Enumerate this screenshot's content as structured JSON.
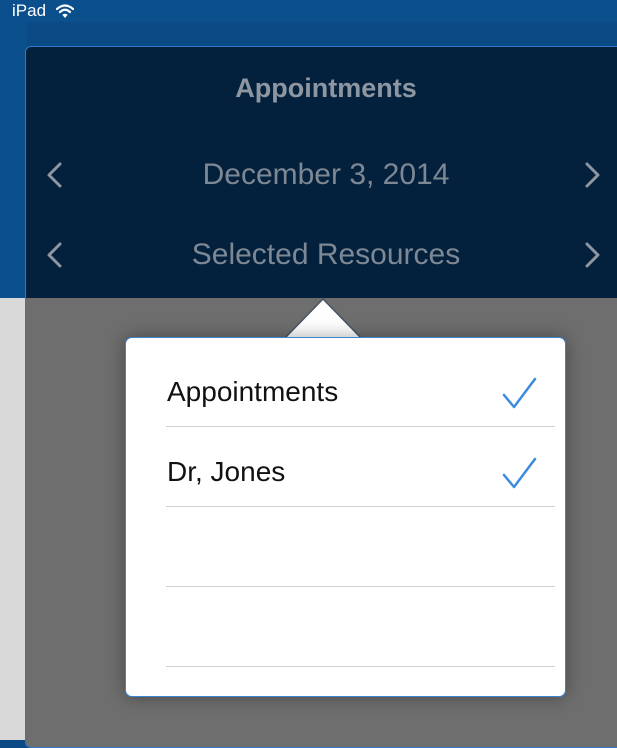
{
  "status_bar": {
    "device": "iPad",
    "icon": "wifi-icon"
  },
  "header": {
    "title": "Appointments",
    "date": "December 3, 2014",
    "resources": "Selected Resources",
    "prev_icon": "chevron-left-icon",
    "next_icon": "chevron-right-icon"
  },
  "popover": {
    "items": [
      {
        "label": "Appointments",
        "checked": true
      },
      {
        "label": "Dr, Jones",
        "checked": true
      },
      {
        "label": "",
        "checked": false
      },
      {
        "label": "",
        "checked": false
      }
    ],
    "check_icon": "checkmark-icon"
  },
  "colors": {
    "brand_blue": "#0b4f8c",
    "header_navy": "#03213d",
    "check_blue": "#3d8ae0",
    "header_text": "#8d96a1"
  }
}
